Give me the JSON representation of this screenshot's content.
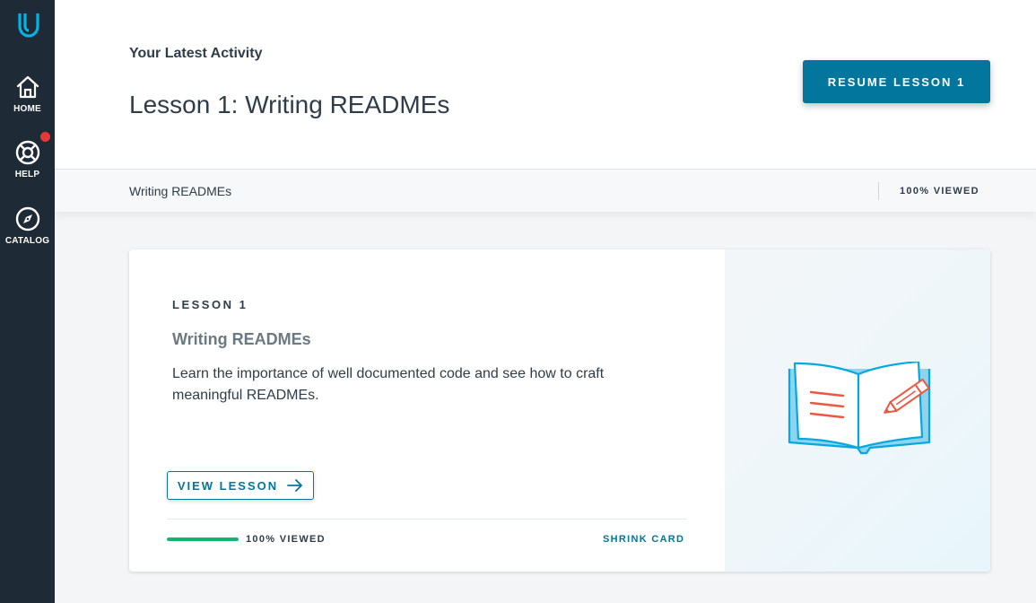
{
  "sidebar": {
    "logo_icon": "udacity-logo-icon",
    "items": [
      {
        "label": "HOME",
        "icon": "home-icon"
      },
      {
        "label": "HELP",
        "icon": "lifebuoy-icon",
        "has_notification": true
      },
      {
        "label": "CATALOG",
        "icon": "compass-icon"
      }
    ]
  },
  "header": {
    "subtitle": "Your Latest Activity",
    "title": "Lesson 1: Writing READMEs",
    "resume_button": "RESUME LESSON 1"
  },
  "progress_strip": {
    "lesson_name": "Writing READMEs",
    "viewed_label": "100% VIEWED"
  },
  "card": {
    "lesson_label": "LESSON 1",
    "title": "Writing READMEs",
    "description": "Learn the importance of well documented code and see how to craft meaningful READMEs.",
    "view_button": "VIEW LESSON",
    "progress_percent": 100,
    "viewed_label": "100% VIEWED",
    "shrink_link": "SHRINK CARD",
    "illustration_icon": "open-book-pencil-icon"
  },
  "colors": {
    "sidebar_bg": "#1e2a35",
    "accent": "#02769c",
    "progress": "#15b371",
    "notification": "#e53935",
    "logo": "#02b3e4"
  }
}
